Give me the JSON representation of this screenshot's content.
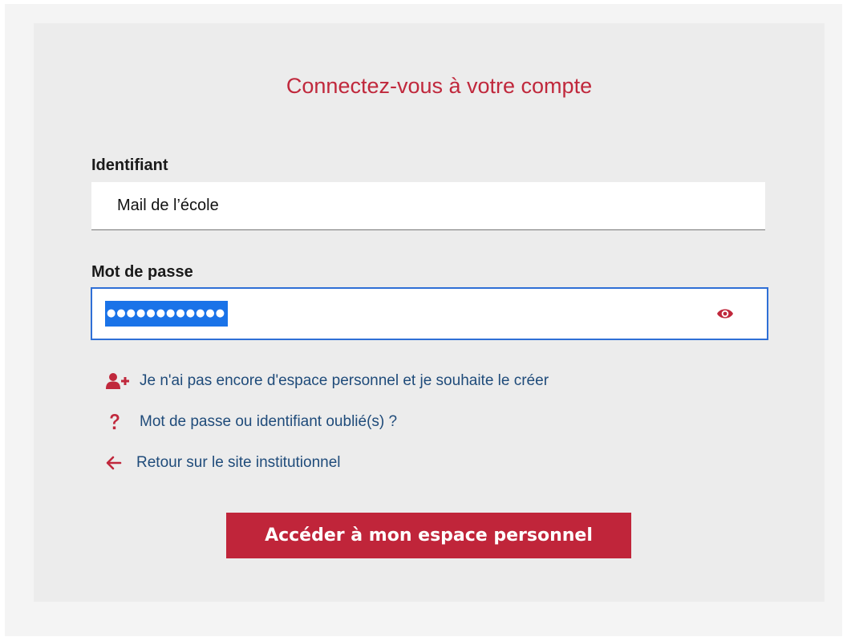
{
  "colors": {
    "accent": "#c0283c",
    "link": "#1f4b7a",
    "focus": "#2f6fd6",
    "selection": "#1a73e8",
    "button": "#c0253a"
  },
  "login": {
    "title": "Connectez-vous à votre compte",
    "identifiant": {
      "label": "Identifiant",
      "value": "Mail de l’école"
    },
    "password": {
      "label": "Mot de passe",
      "masked_value": "●●●●●●●●●●●●",
      "toggle_icon": "eye-icon"
    },
    "links": {
      "create_account": {
        "icon": "user-plus-icon",
        "label": "Je n'ai pas encore d'espace personnel et je souhaite le créer"
      },
      "forgot": {
        "icon": "question-mark-icon",
        "label": "Mot de passe ou identifiant oublié(s) ?"
      },
      "back": {
        "icon": "arrow-left-icon",
        "label": "Retour sur le site institutionnel"
      }
    },
    "submit_label": "Accéder à mon espace personnel"
  }
}
